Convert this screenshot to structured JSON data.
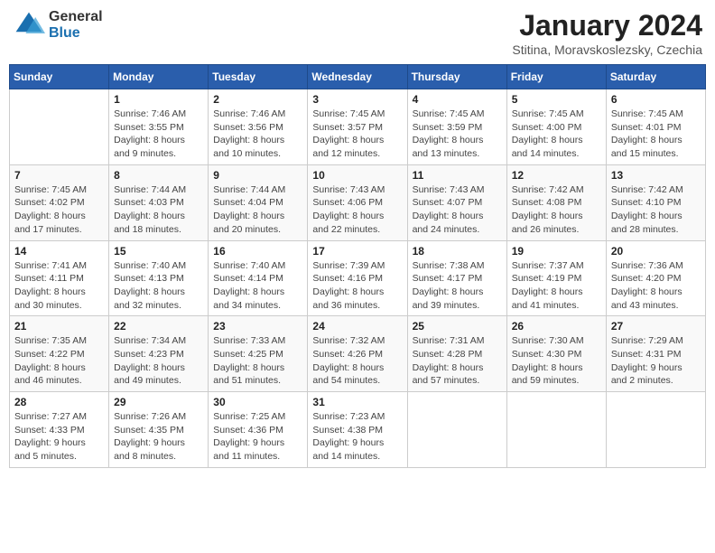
{
  "logo": {
    "general": "General",
    "blue": "Blue"
  },
  "title": "January 2024",
  "subtitle": "Stitina, Moravskoslezsky, Czechia",
  "weekdays": [
    "Sunday",
    "Monday",
    "Tuesday",
    "Wednesday",
    "Thursday",
    "Friday",
    "Saturday"
  ],
  "weeks": [
    [
      {
        "day": "",
        "sunrise": "",
        "sunset": "",
        "daylight": ""
      },
      {
        "day": "1",
        "sunrise": "Sunrise: 7:46 AM",
        "sunset": "Sunset: 3:55 PM",
        "daylight": "Daylight: 8 hours and 9 minutes."
      },
      {
        "day": "2",
        "sunrise": "Sunrise: 7:46 AM",
        "sunset": "Sunset: 3:56 PM",
        "daylight": "Daylight: 8 hours and 10 minutes."
      },
      {
        "day": "3",
        "sunrise": "Sunrise: 7:45 AM",
        "sunset": "Sunset: 3:57 PM",
        "daylight": "Daylight: 8 hours and 12 minutes."
      },
      {
        "day": "4",
        "sunrise": "Sunrise: 7:45 AM",
        "sunset": "Sunset: 3:59 PM",
        "daylight": "Daylight: 8 hours and 13 minutes."
      },
      {
        "day": "5",
        "sunrise": "Sunrise: 7:45 AM",
        "sunset": "Sunset: 4:00 PM",
        "daylight": "Daylight: 8 hours and 14 minutes."
      },
      {
        "day": "6",
        "sunrise": "Sunrise: 7:45 AM",
        "sunset": "Sunset: 4:01 PM",
        "daylight": "Daylight: 8 hours and 15 minutes."
      }
    ],
    [
      {
        "day": "7",
        "sunrise": "Sunrise: 7:45 AM",
        "sunset": "Sunset: 4:02 PM",
        "daylight": "Daylight: 8 hours and 17 minutes."
      },
      {
        "day": "8",
        "sunrise": "Sunrise: 7:44 AM",
        "sunset": "Sunset: 4:03 PM",
        "daylight": "Daylight: 8 hours and 18 minutes."
      },
      {
        "day": "9",
        "sunrise": "Sunrise: 7:44 AM",
        "sunset": "Sunset: 4:04 PM",
        "daylight": "Daylight: 8 hours and 20 minutes."
      },
      {
        "day": "10",
        "sunrise": "Sunrise: 7:43 AM",
        "sunset": "Sunset: 4:06 PM",
        "daylight": "Daylight: 8 hours and 22 minutes."
      },
      {
        "day": "11",
        "sunrise": "Sunrise: 7:43 AM",
        "sunset": "Sunset: 4:07 PM",
        "daylight": "Daylight: 8 hours and 24 minutes."
      },
      {
        "day": "12",
        "sunrise": "Sunrise: 7:42 AM",
        "sunset": "Sunset: 4:08 PM",
        "daylight": "Daylight: 8 hours and 26 minutes."
      },
      {
        "day": "13",
        "sunrise": "Sunrise: 7:42 AM",
        "sunset": "Sunset: 4:10 PM",
        "daylight": "Daylight: 8 hours and 28 minutes."
      }
    ],
    [
      {
        "day": "14",
        "sunrise": "Sunrise: 7:41 AM",
        "sunset": "Sunset: 4:11 PM",
        "daylight": "Daylight: 8 hours and 30 minutes."
      },
      {
        "day": "15",
        "sunrise": "Sunrise: 7:40 AM",
        "sunset": "Sunset: 4:13 PM",
        "daylight": "Daylight: 8 hours and 32 minutes."
      },
      {
        "day": "16",
        "sunrise": "Sunrise: 7:40 AM",
        "sunset": "Sunset: 4:14 PM",
        "daylight": "Daylight: 8 hours and 34 minutes."
      },
      {
        "day": "17",
        "sunrise": "Sunrise: 7:39 AM",
        "sunset": "Sunset: 4:16 PM",
        "daylight": "Daylight: 8 hours and 36 minutes."
      },
      {
        "day": "18",
        "sunrise": "Sunrise: 7:38 AM",
        "sunset": "Sunset: 4:17 PM",
        "daylight": "Daylight: 8 hours and 39 minutes."
      },
      {
        "day": "19",
        "sunrise": "Sunrise: 7:37 AM",
        "sunset": "Sunset: 4:19 PM",
        "daylight": "Daylight: 8 hours and 41 minutes."
      },
      {
        "day": "20",
        "sunrise": "Sunrise: 7:36 AM",
        "sunset": "Sunset: 4:20 PM",
        "daylight": "Daylight: 8 hours and 43 minutes."
      }
    ],
    [
      {
        "day": "21",
        "sunrise": "Sunrise: 7:35 AM",
        "sunset": "Sunset: 4:22 PM",
        "daylight": "Daylight: 8 hours and 46 minutes."
      },
      {
        "day": "22",
        "sunrise": "Sunrise: 7:34 AM",
        "sunset": "Sunset: 4:23 PM",
        "daylight": "Daylight: 8 hours and 49 minutes."
      },
      {
        "day": "23",
        "sunrise": "Sunrise: 7:33 AM",
        "sunset": "Sunset: 4:25 PM",
        "daylight": "Daylight: 8 hours and 51 minutes."
      },
      {
        "day": "24",
        "sunrise": "Sunrise: 7:32 AM",
        "sunset": "Sunset: 4:26 PM",
        "daylight": "Daylight: 8 hours and 54 minutes."
      },
      {
        "day": "25",
        "sunrise": "Sunrise: 7:31 AM",
        "sunset": "Sunset: 4:28 PM",
        "daylight": "Daylight: 8 hours and 57 minutes."
      },
      {
        "day": "26",
        "sunrise": "Sunrise: 7:30 AM",
        "sunset": "Sunset: 4:30 PM",
        "daylight": "Daylight: 8 hours and 59 minutes."
      },
      {
        "day": "27",
        "sunrise": "Sunrise: 7:29 AM",
        "sunset": "Sunset: 4:31 PM",
        "daylight": "Daylight: 9 hours and 2 minutes."
      }
    ],
    [
      {
        "day": "28",
        "sunrise": "Sunrise: 7:27 AM",
        "sunset": "Sunset: 4:33 PM",
        "daylight": "Daylight: 9 hours and 5 minutes."
      },
      {
        "day": "29",
        "sunrise": "Sunrise: 7:26 AM",
        "sunset": "Sunset: 4:35 PM",
        "daylight": "Daylight: 9 hours and 8 minutes."
      },
      {
        "day": "30",
        "sunrise": "Sunrise: 7:25 AM",
        "sunset": "Sunset: 4:36 PM",
        "daylight": "Daylight: 9 hours and 11 minutes."
      },
      {
        "day": "31",
        "sunrise": "Sunrise: 7:23 AM",
        "sunset": "Sunset: 4:38 PM",
        "daylight": "Daylight: 9 hours and 14 minutes."
      },
      {
        "day": "",
        "sunrise": "",
        "sunset": "",
        "daylight": ""
      },
      {
        "day": "",
        "sunrise": "",
        "sunset": "",
        "daylight": ""
      },
      {
        "day": "",
        "sunrise": "",
        "sunset": "",
        "daylight": ""
      }
    ]
  ]
}
